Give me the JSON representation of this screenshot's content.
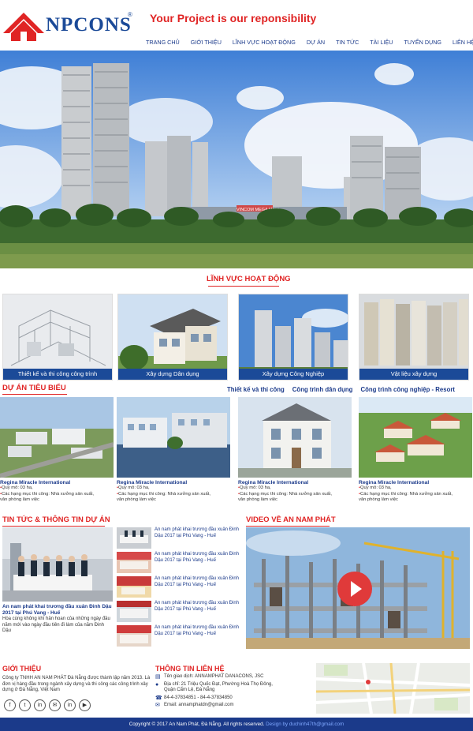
{
  "header": {
    "brand": "NPCONS",
    "brand_first": "A",
    "registered": "®",
    "slogan": "Your Project is our reponsibility"
  },
  "nav": [
    "TRANG CHỦ",
    "GIỚI THIỆU",
    "LĨNH VỰC HOẠT ĐỘNG",
    "DỰ ÁN",
    "TIN TỨC",
    "TÀI LIỆU",
    "TUYỂN DỤNG",
    "LIÊN HỆ"
  ],
  "banner": {
    "sign": "VINCOM MEGA MALL"
  },
  "fields": {
    "title": "LĨNH VỰC HOẠT ĐỘNG",
    "items": [
      "Thiết kế và thi công công trình",
      "Xây dựng Dân dụng",
      "Xây dựng Công Nghiệp",
      "Vật liệu xây dựng"
    ]
  },
  "projects": {
    "title": "DỰ ÁN TIÊU BIỂU",
    "tabs": [
      "Thiết kế và thi công",
      "Công trình dân dụng",
      "Công trình công nghiệp - Resort"
    ],
    "items": [
      {
        "name": "Regina Miracle International",
        "line1": "Quy mô: 03 ha,",
        "line2": "Các hạng mục thi công: Nhà xưởng sản xuất,",
        "line3": "văn phòng làm việc"
      },
      {
        "name": "Regina Miracle International",
        "line1": "Quy mô: 03 ha,",
        "line2": "Các hạng mục thi công: Nhà xưởng sản xuất,",
        "line3": "văn phòng làm việc"
      },
      {
        "name": "Regina Miracle International",
        "line1": "Quy mô: 03 ha,",
        "line2": "Các hạng mục thi công: Nhà xưởng sản xuất,",
        "line3": "văn phòng làm việc"
      },
      {
        "name": "Regina Miracle International",
        "line1": "Quy mô: 03 ha,",
        "line2": "Các hạng mục thi công: Nhà xưởng sản xuất,",
        "line3": "văn phòng làm việc"
      }
    ]
  },
  "news": {
    "title": "TIN TỨC & THÔNG TIN DỰ ÁN",
    "main_title": "An nam phát khai trương đầu xuân Đinh Dậu 2017 tại Phú Vang - Huế",
    "main_desc": "Hòa cùng không khí hân hoan của những ngày đầu năm mới vào ngày đầu tiên đi làm của năm Đinh Dậu",
    "list": [
      "An nam phát khai trương đầu xuân Đinh Dậu 2017 tại Phú Vang - Huế",
      "An nam phát khai trương đầu xuân Đinh Dậu 2017 tại Phú Vang - Huế",
      "An nam phát khai trương đầu xuân Đinh Dậu 2017 tại Phú Vang - Huế",
      "An nam phát khai trương đầu xuân Đinh Dậu 2017 tại Phú Vang - Huế",
      "An nam phát khai trương đầu xuân Đinh Dậu 2017 tại Phú Vang - Huế"
    ]
  },
  "video": {
    "title": "VIDEO VỀ AN NAM PHÁT"
  },
  "about": {
    "title": "GIỚI THIỆU",
    "text": "Công ty TNHH AN NAM PHÁT Đà Nẵng được thành lập năm 2013. Là đơn vị hàng đầu trong ngành xây dựng và thi công các công trình xây dựng ở Đà Nẵng, Việt Nam"
  },
  "contact": {
    "title": "THÔNG TIN LIÊN HỆ",
    "name": "Tên giao dịch: ANNAMPHAT DANACONS, JSC",
    "address1": "Địa chỉ: 21 Triệu Quốc Đạt, Phường Hoà Thọ Đông,",
    "address2": "Quận Cẩm Lệ, Đà Nẵng",
    "phone": "84-4-37834851 - 84-4-37834850",
    "email": "Email: annamphatdn@gmail.com"
  },
  "social": [
    "f",
    "t",
    "in",
    "✉",
    "in",
    "▶"
  ],
  "footer": {
    "copyright": "Copyright © 2017 An Nam Phát, Đà Nẵng. All rights reserved.",
    "design": "Design by duchinh47th@gmail.com"
  },
  "colors": {
    "accent": "#e02424",
    "brand": "#1b4a98",
    "footer": "#1b3a8a"
  }
}
